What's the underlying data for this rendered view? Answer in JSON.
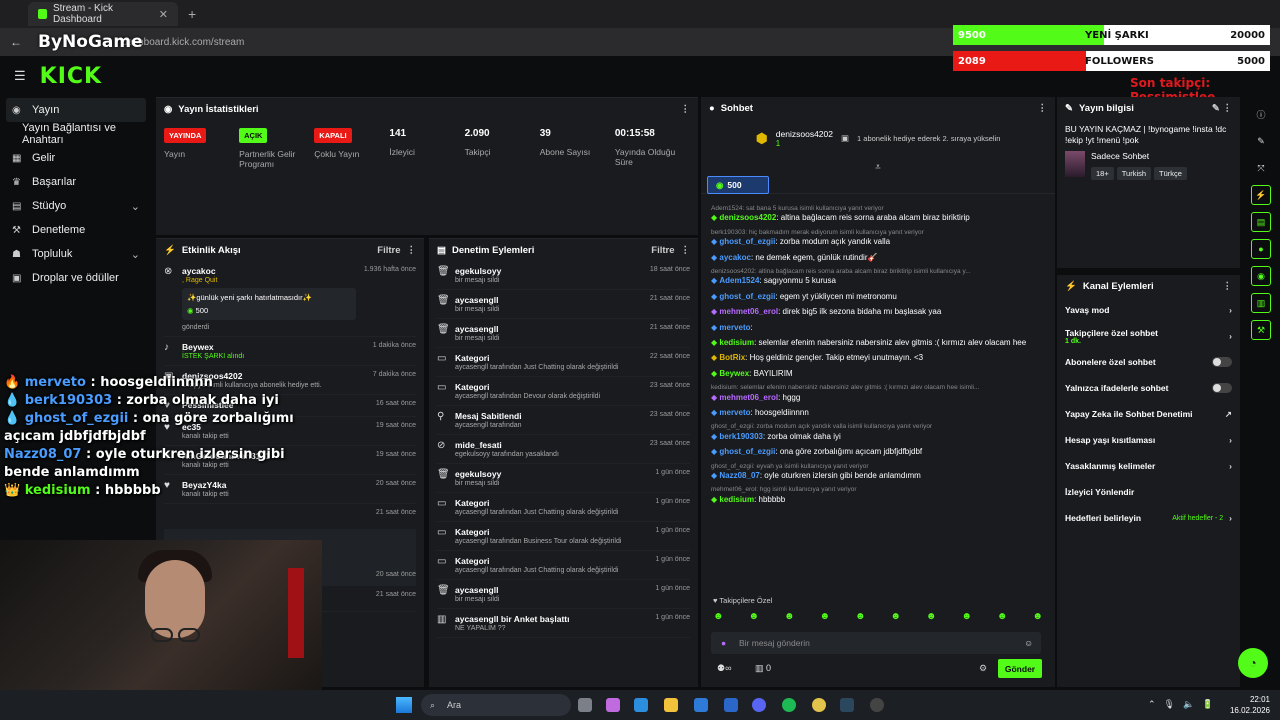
{
  "browser": {
    "tab_title": "Stream - Kick Dashboard",
    "address": "dashboard.kick.com/stream"
  },
  "overlay": {
    "brand": "ByNoGame",
    "song_bar": {
      "left": "9500",
      "mid": "YENİ ŞARKI",
      "right": "20000",
      "color": "#53fc18",
      "fraction": 0.475
    },
    "followers_bar": {
      "left": "2089",
      "mid": "FOLLOWERS",
      "right": "5000",
      "color": "#e91916",
      "fraction": 0.418
    },
    "last_follower": "Son takipçi: Pessimistlee",
    "chat": [
      {
        "user": "merveto",
        "text": " : hoosgeldiinnnn",
        "badge": "🔥"
      },
      {
        "user": "berk190303",
        "text": " : zorba olmak daha iyi",
        "badge": "💧"
      },
      {
        "user": "ghost_of_ezgii",
        "text": " : ona göre zorbalığımı açıcam jdbfjdfbjdbf",
        "badge": "💧"
      },
      {
        "user": "Nazz08_07",
        "text": " : oyle oturkren izlersin gibi bende anlamdımm",
        "badge": ""
      },
      {
        "user": "kedisium",
        "text": " : hbbbbb",
        "badge": "👑"
      }
    ]
  },
  "sidebar": {
    "items": [
      {
        "label": "Yayın"
      },
      {
        "label": "Yayın Bağlantısı ve Anahtarı"
      },
      {
        "label": "Gelir"
      },
      {
        "label": "Başarılar"
      },
      {
        "label": "Stüdyo"
      },
      {
        "label": "Denetleme"
      },
      {
        "label": "Topluluk"
      },
      {
        "label": "Droplar ve ödüller"
      }
    ]
  },
  "stats_panel": {
    "title": "Yayın İstatistikleri",
    "items": [
      {
        "badge": "YAYINDA",
        "label": "Yayın"
      },
      {
        "badge": "AÇIK",
        "label": "Partnerlik Gelir Programı"
      },
      {
        "badge": "KAPALI",
        "label": "Çoklu Yayın"
      },
      {
        "value": "141",
        "label": "İzleyici"
      },
      {
        "value": "2.090",
        "label": "Takipçi"
      },
      {
        "value": "39",
        "label": "Abone Sayısı"
      },
      {
        "value": "00:15:58",
        "label": "Yayında Olduğu Süre"
      }
    ]
  },
  "activity": {
    "title": "Etkinlik Akışı",
    "filter": "Filtre",
    "rows": [
      {
        "name": "aycakoc",
        "sub": ", Rage Quit",
        "time": "1.936 hafta önce",
        "note": "✨günlük yeni şarkı hatırlatmasıdır✨",
        "amount": "500",
        "foot": "gönderdi"
      },
      {
        "name": "Beywex",
        "sub": "İSTEK ŞARKI alındı",
        "time": "1 dakika önce"
      },
      {
        "name": "denizsoos4202",
        "sub": "1 kişiye isimli kullanıcıya abonelik hediye etti.",
        "time": "7 dakika önce"
      },
      {
        "name": "Pessimistlee",
        "sub": "",
        "time": "16 saat önce"
      },
      {
        "name": "ec35",
        "sub": "kanalı takip etti",
        "time": "19 saat önce"
      },
      {
        "name": "AmGoluCanavari3131",
        "sub": "kanalı takip etti",
        "time": "19 saat önce"
      },
      {
        "name": "BeyazY4ka",
        "sub": "kanalı takip etti",
        "time": "20 saat önce"
      },
      {
        "name": "",
        "sub": "",
        "time": "21 saat önce"
      },
      {
        "name": "",
        "sub": "",
        "time": "20 saat önce"
      },
      {
        "name": "",
        "sub": "",
        "time": "21 saat önce"
      }
    ]
  },
  "moderation": {
    "title": "Denetim Eylemleri",
    "filter": "Filtre",
    "rows": [
      {
        "name": "egekulsoyy",
        "sub": "bir mesajı sildi",
        "time": "18 saat önce"
      },
      {
        "name": "aycasengll",
        "sub": "bir mesajı sildi",
        "time": "21 saat önce"
      },
      {
        "name": "aycasengll",
        "sub": "bir mesajı sildi",
        "time": "21 saat önce"
      },
      {
        "name": "Kategori",
        "sub": "aycasengll tarafından Just Chatting olarak değiştirildi",
        "time": "22 saat önce"
      },
      {
        "name": "Kategori",
        "sub": "aycasengll tarafından Devour olarak değiştirildi",
        "time": "23 saat önce"
      },
      {
        "name": "Mesaj Sabitlendi",
        "sub": "aycasengll tarafından",
        "time": "23 saat önce"
      },
      {
        "name": "mide_fesati",
        "sub": "egekulsoyy tarafından yasaklandı",
        "time": "23 saat önce"
      },
      {
        "name": "egekulsoyy",
        "sub": "bir mesajı sildi",
        "time": "1 gün önce"
      },
      {
        "name": "Kategori",
        "sub": "aycasengll tarafından Just Chatting olarak değiştirildi",
        "time": "1 gün önce"
      },
      {
        "name": "Kategori",
        "sub": "aycasengll tarafından Business Tour olarak değiştirildi",
        "time": "1 gün önce"
      },
      {
        "name": "Kategori",
        "sub": "aycasengll tarafından Just Chatting olarak değiştirildi",
        "time": "1 gün önce"
      },
      {
        "name": "aycasengll",
        "sub": "bir mesajı sildi",
        "time": "1 gün önce"
      },
      {
        "name": "aycasengll bir Anket başlattı",
        "sub": "NE YAPALIM ??",
        "time": "1 gün önce"
      }
    ]
  },
  "chat": {
    "title": "Sohbet",
    "sub_user": "denizsoos4202",
    "sub_count": "1",
    "sub_text": "1 abonelik hediye ederek 2. sıraya yükselin",
    "pill": "500",
    "messages": [
      {
        "reply": "Adem1524: sat bana 5 kurusa isimli kullanıcıya yanıt veriyor",
        "user": "denizsoos4202",
        "text": ": altina bağlacam reis sorna araba alcam biraz biriktirip",
        "color": "#53fc18"
      },
      {
        "reply": "berk190303: hiç bakmadım merak ediyorum isimli kullanıcıya yanıt veriyor",
        "user": "ghost_of_ezgii",
        "text": ": zorba modum açık yandık valla",
        "color": "#4a9cff"
      },
      {
        "reply": "",
        "user": "aycakoc",
        "text": ": ne demek egem, günlük rutindir🎸",
        "color": "#4a9cff"
      },
      {
        "reply": "denizsoos4202: altina bağlacam reis sorna araba alcam biraz biriktirip isimli kullanıcıya y...",
        "user": "Adem1524",
        "text": ": sagıyonmu 5 kurusa",
        "color": "#4a9cff"
      },
      {
        "reply": "",
        "user": "ghost_of_ezgii",
        "text": ": egem yt yükliycen mi metronomu",
        "color": "#4a9cff"
      },
      {
        "reply": "",
        "user": "mehmet06_erol",
        "text": ": direk big5 ilk sezona bidaha mı başlasak yaa",
        "color": "#b86bff"
      },
      {
        "reply": "",
        "user": "merveto",
        "text": ":",
        "color": "#4a9cff"
      },
      {
        "reply": "",
        "user": "kedisium",
        "text": ": selemlar efenim nabersiniz nabersiniz alev gitmis :( kırmızı alev olacam hee",
        "color": "#53fc18"
      },
      {
        "reply": "",
        "user": "BotRix",
        "text": ": Hoş geldiniz gençler. Takip etmeyi unutmayın. <3",
        "color": "#e0b800"
      },
      {
        "reply": "",
        "user": "Beywex",
        "text": ": BAYILIRIM",
        "color": "#53fc18"
      },
      {
        "reply": "kedisium: selemlar efenim nabersiniz nabersiniz alev gitmis :( kırmızı alev olacam hee isimli...",
        "user": "mehmet06_erol",
        "text": ": hggg",
        "color": "#b86bff"
      },
      {
        "reply": "",
        "user": "merveto",
        "text": ": hoosgeldiinnnn",
        "color": "#4a9cff"
      },
      {
        "reply": "ghost_of_ezgii: zorba modum açık yandık valla isimli kullanıcıya yanıt veriyor",
        "user": "berk190303",
        "text": ": zorba olmak daha iyi",
        "color": "#4a9cff"
      },
      {
        "reply": "",
        "user": "ghost_of_ezgii",
        "text": ": ona göre zorbalığımı açıcam jdbfjdfbjdbf",
        "color": "#4a9cff"
      },
      {
        "reply": "ghost_of_ezgii: eyvah ya isimli kullanıcıya yanıt veriyor",
        "user": "Nazz08_07",
        "text": ": oyle oturkren izlersin gibi bende anlamdımm",
        "color": "#4a9cff"
      },
      {
        "reply": "mehmet06_erol: hgg isimli kullanıcıya yanıt veriyor",
        "user": "kedisium",
        "text": ": hbbbbb",
        "color": "#53fc18"
      }
    ],
    "followers_only": "Takipçilere Özel",
    "placeholder": "Bir mesaj gönderin",
    "points": "0",
    "send": "Gönder"
  },
  "stream_info": {
    "title": "Yayın bilgisi",
    "text": "BU YAYIN KAÇMAZ | !bynogame !insta !dc !ekip !yt !menü !pok",
    "category": "Sadece Sohbet",
    "tags": [
      "18+",
      "Turkish",
      "Türkçe"
    ]
  },
  "channel_actions": {
    "title": "Kanal Eylemleri",
    "items": [
      {
        "label": "Yavaş mod",
        "kind": "arrow"
      },
      {
        "label": "Takipçilere özel sohbet",
        "sub": "1 dk.",
        "kind": "arrow"
      },
      {
        "label": "Abonelere özel sohbet",
        "kind": "toggle"
      },
      {
        "label": "Yalnızca ifadelerle sohbet",
        "kind": "toggle"
      },
      {
        "label": "Yapay Zeka ile Sohbet Denetimi",
        "kind": "link"
      },
      {
        "label": "Hesap yaşı kısıtlaması",
        "kind": "arrow"
      },
      {
        "label": "Yasaklanmış kelimeler",
        "kind": "arrow"
      },
      {
        "label": "İzleyici Yönlendir",
        "kind": "none"
      },
      {
        "label": "Hedefleri belirleyin",
        "sub": "Aktif hedefler - 2",
        "kind": "arrow"
      }
    ]
  },
  "taskbar": {
    "search": "Ara",
    "time": "22:01",
    "date": "16.02.2026"
  }
}
